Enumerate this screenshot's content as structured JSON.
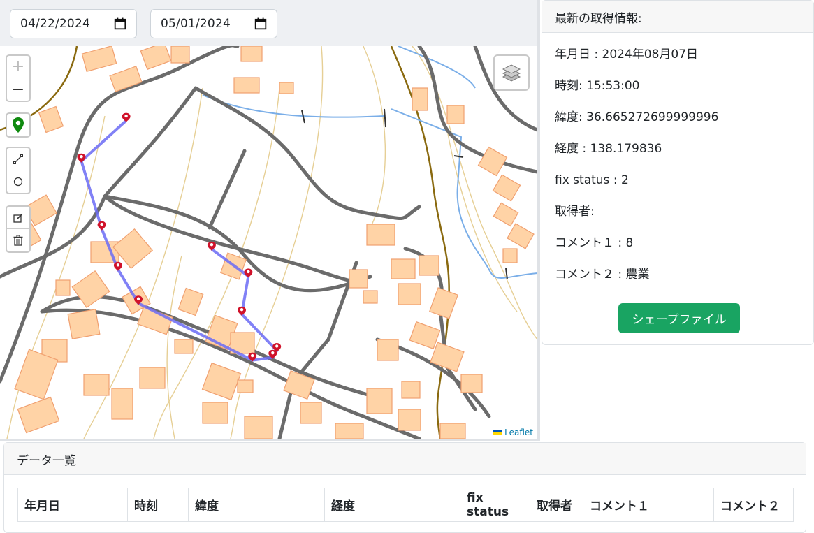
{
  "date_filter": {
    "start": "04/22/2024",
    "end": "05/01/2024"
  },
  "map": {
    "controls": {
      "zoom_in": "+",
      "zoom_out": "−"
    },
    "attribution": "Leaflet",
    "colors": {
      "track": "#6b6bf5",
      "marker": "#d0122a",
      "building_fill": "#ffd3a6",
      "building_stroke": "#f0a070",
      "road": "#6b6b6b",
      "contour": "#e6cf95",
      "boundary": "#8a6a10",
      "water": "#7aaee8"
    },
    "track_points": [
      {
        "lat": 36.6672,
        "lng": 138.17755
      },
      {
        "lat": 36.6669,
        "lng": 138.177
      },
      {
        "lat": 36.6664,
        "lng": 138.17725
      },
      {
        "lat": 36.6661,
        "lng": 138.17745
      },
      {
        "lat": 36.66585,
        "lng": 138.1777
      },
      {
        "lat": 36.66543,
        "lng": 138.1791
      },
      {
        "lat": 36.66545,
        "lng": 138.17935
      },
      {
        "lat": 36.6655,
        "lng": 138.1794
      },
      {
        "lat": 36.66577,
        "lng": 138.17897
      },
      {
        "lat": 36.66605,
        "lng": 138.17905
      },
      {
        "lat": 36.66625,
        "lng": 138.1786
      }
    ]
  },
  "latest": {
    "header": "最新の取得情報:",
    "date": "年月日 : 2024年08月07日",
    "time": "時刻: 15:53:00",
    "lat": "緯度: 36.665272699999996",
    "lng": "経度 : 138.179836",
    "fix": "fix status : 2",
    "user": "取得者:",
    "comment1": "コメント１ : 8",
    "comment2": "コメント２ : 農業",
    "button": "シェープファイル",
    "button_color": "#19a462"
  },
  "list": {
    "header": "データ一覧",
    "columns": [
      "年月日",
      "時刻",
      "緯度",
      "経度",
      "fix status",
      "取得者",
      "コメント１",
      "コメント２"
    ]
  }
}
